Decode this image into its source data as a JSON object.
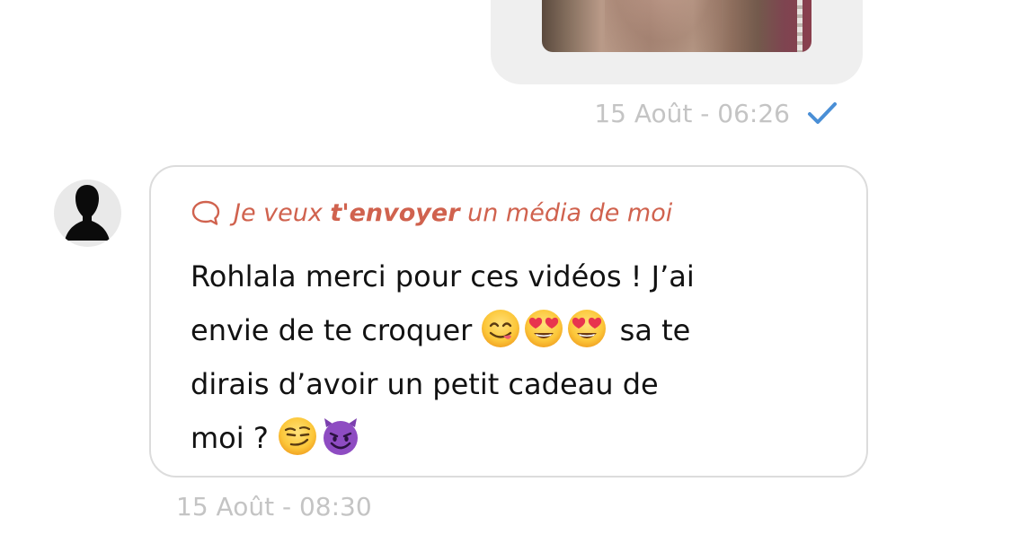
{
  "outgoing_message": {
    "media_icon": "photo-thumbnail",
    "timestamp": "15 Août - 06:26",
    "status_icon": "check-icon",
    "status_color": "#4a8fd6"
  },
  "incoming_message": {
    "avatar_icon": "person-silhouette-icon",
    "reply_icon": "chat-bubble-icon",
    "reply": {
      "before": "Je veux ",
      "bold": "t'envoyer",
      "after": " un média de moi",
      "color": "#d0624e"
    },
    "lines": [
      "Rohlala merci pour ces vidéos ! J’ai",
      "envie de te croquer",
      "sa te",
      "dirais d’avoir un petit cadeau de",
      "moi ?"
    ],
    "emojis": [
      "savoring-face-emoji",
      "heart-eyes-emoji",
      "heart-eyes-emoji",
      "smirking-face-emoji",
      "smiling-devil-emoji"
    ],
    "timestamp": "15 Août - 08:30"
  }
}
